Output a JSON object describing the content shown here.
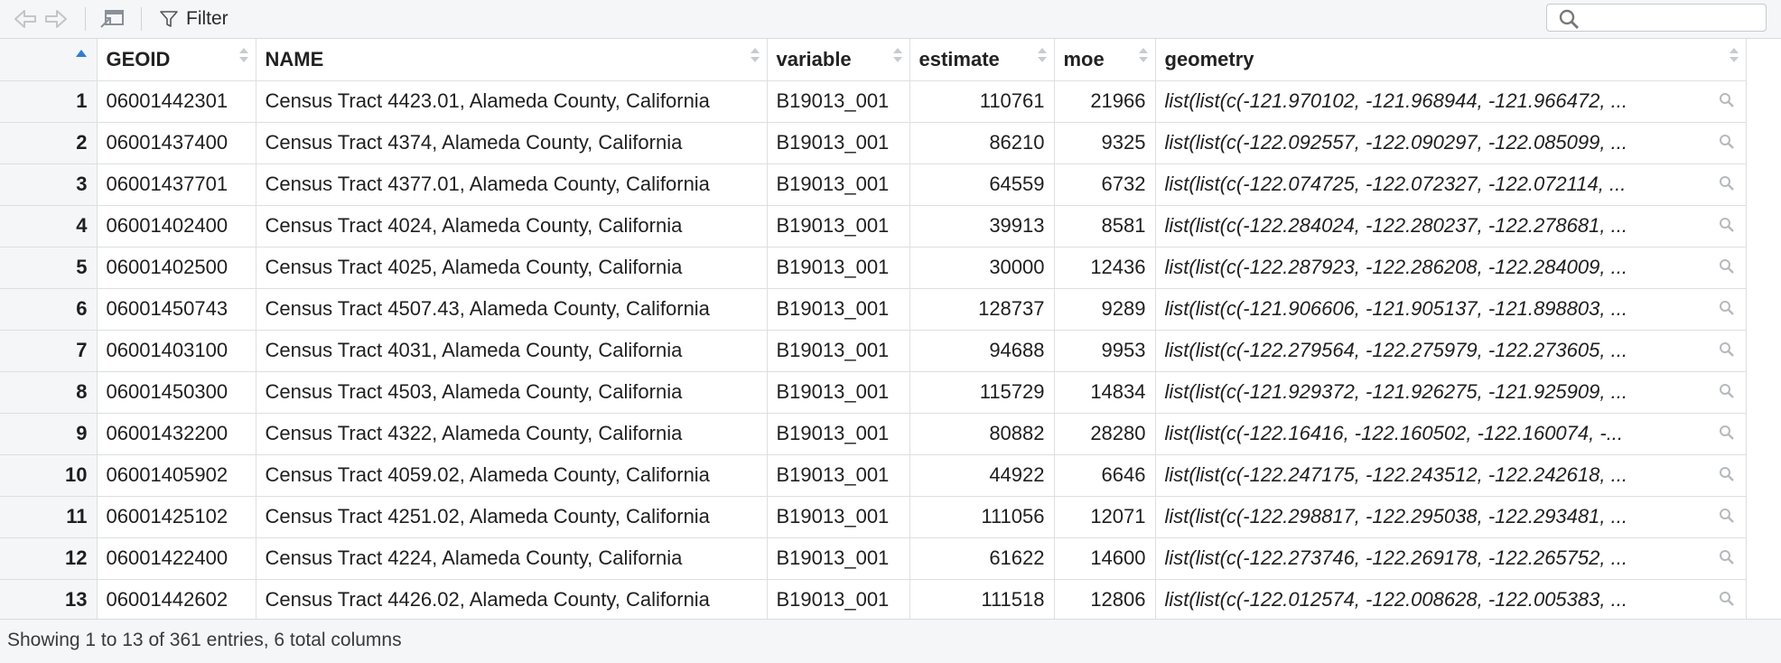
{
  "toolbar": {
    "filter_label": "Filter",
    "search_placeholder": ""
  },
  "table": {
    "columns": [
      "GEOID",
      "NAME",
      "variable",
      "estimate",
      "moe",
      "geometry"
    ],
    "rows": [
      {
        "n": "1",
        "geoid": "06001442301",
        "name": "Census Tract 4423.01, Alameda County, California",
        "variable": "B19013_001",
        "estimate": "110761",
        "moe": "21966",
        "geometry": "list(list(c(-121.970102, -121.968944, -121.966472, ..."
      },
      {
        "n": "2",
        "geoid": "06001437400",
        "name": "Census Tract 4374, Alameda County, California",
        "variable": "B19013_001",
        "estimate": "86210",
        "moe": "9325",
        "geometry": "list(list(c(-122.092557, -122.090297, -122.085099, ..."
      },
      {
        "n": "3",
        "geoid": "06001437701",
        "name": "Census Tract 4377.01, Alameda County, California",
        "variable": "B19013_001",
        "estimate": "64559",
        "moe": "6732",
        "geometry": "list(list(c(-122.074725, -122.072327, -122.072114, ..."
      },
      {
        "n": "4",
        "geoid": "06001402400",
        "name": "Census Tract 4024, Alameda County, California",
        "variable": "B19013_001",
        "estimate": "39913",
        "moe": "8581",
        "geometry": "list(list(c(-122.284024, -122.280237, -122.278681, ..."
      },
      {
        "n": "5",
        "geoid": "06001402500",
        "name": "Census Tract 4025, Alameda County, California",
        "variable": "B19013_001",
        "estimate": "30000",
        "moe": "12436",
        "geometry": "list(list(c(-122.287923, -122.286208, -122.284009, ..."
      },
      {
        "n": "6",
        "geoid": "06001450743",
        "name": "Census Tract 4507.43, Alameda County, California",
        "variable": "B19013_001",
        "estimate": "128737",
        "moe": "9289",
        "geometry": "list(list(c(-121.906606, -121.905137, -121.898803, ..."
      },
      {
        "n": "7",
        "geoid": "06001403100",
        "name": "Census Tract 4031, Alameda County, California",
        "variable": "B19013_001",
        "estimate": "94688",
        "moe": "9953",
        "geometry": "list(list(c(-122.279564, -122.275979, -122.273605, ..."
      },
      {
        "n": "8",
        "geoid": "06001450300",
        "name": "Census Tract 4503, Alameda County, California",
        "variable": "B19013_001",
        "estimate": "115729",
        "moe": "14834",
        "geometry": "list(list(c(-121.929372, -121.926275, -121.925909, ..."
      },
      {
        "n": "9",
        "geoid": "06001432200",
        "name": "Census Tract 4322, Alameda County, California",
        "variable": "B19013_001",
        "estimate": "80882",
        "moe": "28280",
        "geometry": "list(list(c(-122.16416, -122.160502, -122.160074, -..."
      },
      {
        "n": "10",
        "geoid": "06001405902",
        "name": "Census Tract 4059.02, Alameda County, California",
        "variable": "B19013_001",
        "estimate": "44922",
        "moe": "6646",
        "geometry": "list(list(c(-122.247175, -122.243512, -122.242618, ..."
      },
      {
        "n": "11",
        "geoid": "06001425102",
        "name": "Census Tract 4251.02, Alameda County, California",
        "variable": "B19013_001",
        "estimate": "111056",
        "moe": "12071",
        "geometry": "list(list(c(-122.298817, -122.295038, -122.293481, ..."
      },
      {
        "n": "12",
        "geoid": "06001422400",
        "name": "Census Tract 4224, Alameda County, California",
        "variable": "B19013_001",
        "estimate": "61622",
        "moe": "14600",
        "geometry": "list(list(c(-122.273746, -122.269178, -122.265752, ..."
      },
      {
        "n": "13",
        "geoid": "06001442602",
        "name": "Census Tract 4426.02, Alameda County, California",
        "variable": "B19013_001",
        "estimate": "111518",
        "moe": "12806",
        "geometry": "list(list(c(-122.012574, -122.008628, -122.005383, ..."
      }
    ]
  },
  "footer": {
    "status": "Showing 1 to 13 of 361 entries, 6 total columns"
  }
}
